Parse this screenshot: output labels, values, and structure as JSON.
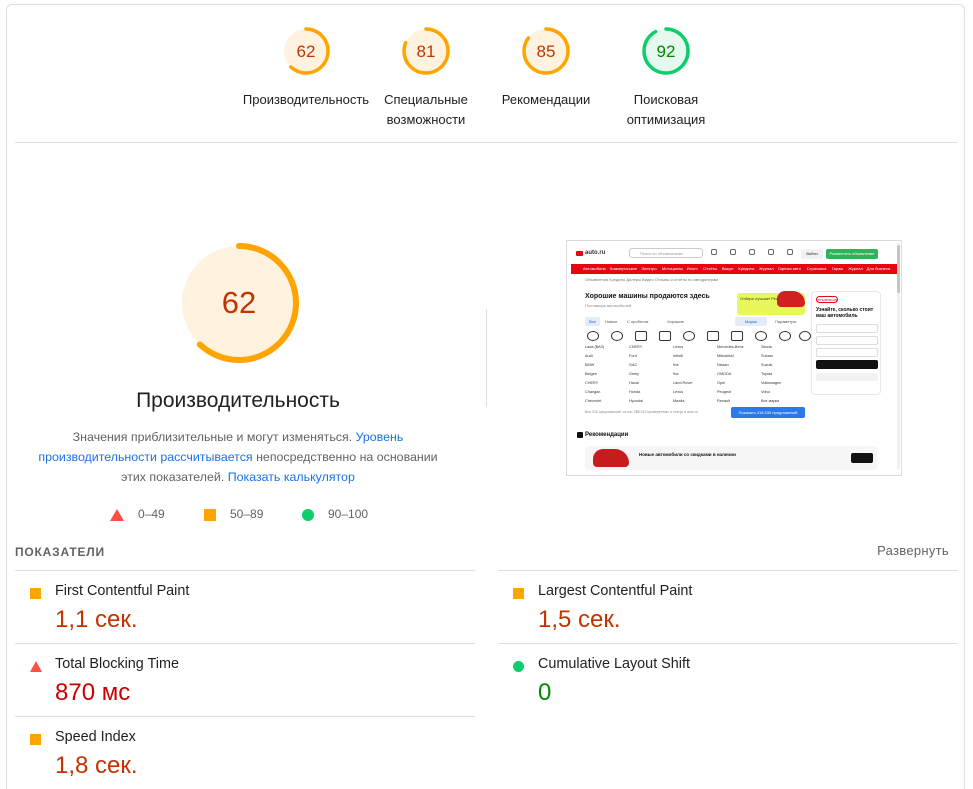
{
  "summary_gauges": [
    {
      "score": "62",
      "label_line1": "Производительность",
      "label_line2": "",
      "rating": "average"
    },
    {
      "score": "81",
      "label_line1": "Специальные",
      "label_line2": "возможности",
      "rating": "average"
    },
    {
      "score": "85",
      "label_line1": "Рекомендации",
      "label_line2": "",
      "rating": "average"
    },
    {
      "score": "92",
      "label_line1": "Поисковая",
      "label_line2": "оптимизация",
      "rating": "pass"
    }
  ],
  "colors": {
    "average": "#ffa400",
    "average_fill": "#fff3e0",
    "average_text": "#c33300",
    "pass": "#0cce6b",
    "pass_fill": "#e6f9ee",
    "pass_text": "#008800",
    "fail": "#ff4e42",
    "fail_text": "#cc0000",
    "link": "#1a73e8"
  },
  "main_gauge": {
    "score": "62",
    "score_fraction": 0.62,
    "title": "Производительность"
  },
  "note": {
    "text1": "Значения приблизительные и могут изменяться. ",
    "link1": "Уровень производительности рассчитывается",
    "text2": " непосредственно на основании этих показателей. ",
    "link2": "Показать калькулятор"
  },
  "legend": [
    {
      "icon": "triangle-icon",
      "range": "0–49"
    },
    {
      "icon": "square-icon",
      "range": "50–89"
    },
    {
      "icon": "circle-icon",
      "range": "90–100"
    }
  ],
  "screenshot": {
    "site_logo": "auto.ru",
    "search_placeholder": "Поиск по объявлениям",
    "login": "Войти",
    "place_ad": "Разместить объявление",
    "nav_items": [
      "Автомобили",
      "Коммерческие",
      "Электро",
      "Мотоциклы",
      "Иного",
      "Отчёты",
      "Выкуп",
      "Кредиты",
      "Журнал",
      "Оценка авто",
      "Страховка",
      "Гараж",
      "Журнал",
      "Для бизнеса"
    ],
    "sub_nav": "Объявления    Кредиты    Дилеры    Видео    Отзывы и отчёты по автодилерам",
    "heading": "Хорошие машины продаются здесь",
    "sub_heading": "Поставщик автомобилей",
    "tabs": [
      "Все",
      "Новые",
      "С пробегом",
      "Хорошие"
    ],
    "right_tabs": [
      "Марки",
      "Параметры"
    ],
    "promo": "Отбери лучшие! Рекорды 2024",
    "brands_rows": [
      [
        "Lada (ВАЗ)",
        "CHERY",
        "Lexus",
        "Mercedes-Benz",
        "Skoda"
      ],
      [
        "Audi",
        "Ford",
        "Infiniti",
        "Mitsubishi",
        "Subaru"
      ],
      [
        "BMW",
        "GAC",
        "Kia",
        "Nissan",
        "Suzuki"
      ],
      [
        "Belgee",
        "Geely",
        "Kia",
        "OMODA",
        "Toyota"
      ],
      [
        "CHERY",
        "Haval",
        "Land Rover",
        "Opel",
        "Volkswagen"
      ],
      [
        "Changan",
        "Honda",
        "Lexus",
        "Peugeot",
        "Volvo"
      ],
      [
        "Chevrolet",
        "Hyundai",
        "Mazda",
        "Renault",
        "Все марки"
      ]
    ],
    "footer": "Все 316 предложений, из них 288 012 проверенных и статус в auto.ru",
    "show_btn": "Показать 416 530 предложений",
    "side_badge": "ОБЪЯВЛЕНИЕ",
    "side_title": "Узнайте, сколько стоит ваш автомобиль",
    "recs": "Рекомендации",
    "banner": "Новые автомобили со скидками в наличии"
  },
  "metrics_header": "ПОКАЗАТЕЛИ",
  "expand_label": "Развернуть",
  "metrics": [
    {
      "name": "First Contentful Paint",
      "value": "1,1 сек.",
      "rating": "average",
      "icon": "square-icon"
    },
    {
      "name": "Largest Contentful Paint",
      "value": "1,5 сек.",
      "rating": "average",
      "icon": "square-icon"
    },
    {
      "name": "Total Blocking Time",
      "value": "870 мс",
      "rating": "fail",
      "icon": "triangle-icon"
    },
    {
      "name": "Cumulative Layout Shift",
      "value": "0",
      "rating": "pass",
      "icon": "circle-icon"
    },
    {
      "name": "Speed Index",
      "value": "1,8 сек.",
      "rating": "average",
      "icon": "square-icon"
    }
  ]
}
